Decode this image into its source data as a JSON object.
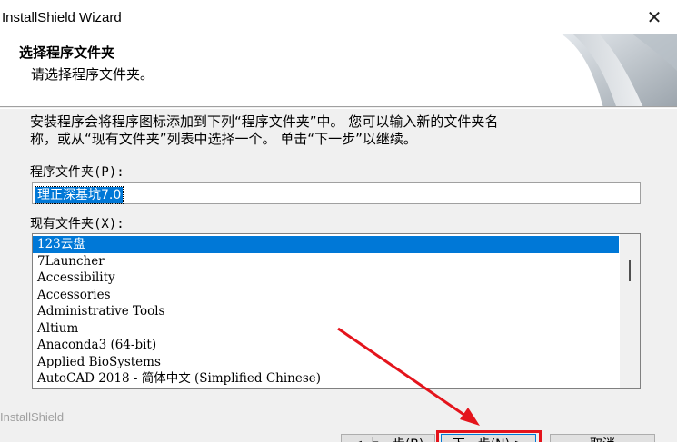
{
  "window": {
    "title": "InstallShield Wizard",
    "close_glyph": "✕"
  },
  "header": {
    "title": "选择程序文件夹",
    "subtitle": "请选择程序文件夹。"
  },
  "description": {
    "line1": "安装程序会将程序图标添加到下列“程序文件夹”中。  您可以输入新的文件夹名",
    "line2": "称，或从“现有文件夹”列表中选择一个。  单击“下一步”以继续。"
  },
  "program_folder": {
    "label": "程序文件夹(P):",
    "value": "理正深基坑7.0"
  },
  "existing_folders": {
    "label": "现有文件夹(X):",
    "items": [
      "123云盘",
      "7Launcher",
      "Accessibility",
      "Accessories",
      "Administrative Tools",
      "Altium",
      "Anaconda3 (64-bit)",
      "Applied BioSystems",
      "AutoCAD 2018 - 简体中文 (Simplified Chinese)"
    ],
    "selected_index": 0
  },
  "footer": {
    "brand": "InstallShield",
    "back_label": "< 上一步(B)",
    "next_label": "下一步(N) >",
    "cancel_label": "取消"
  },
  "colors": {
    "selection": "#0078d7",
    "annotation": "#e4141c"
  }
}
